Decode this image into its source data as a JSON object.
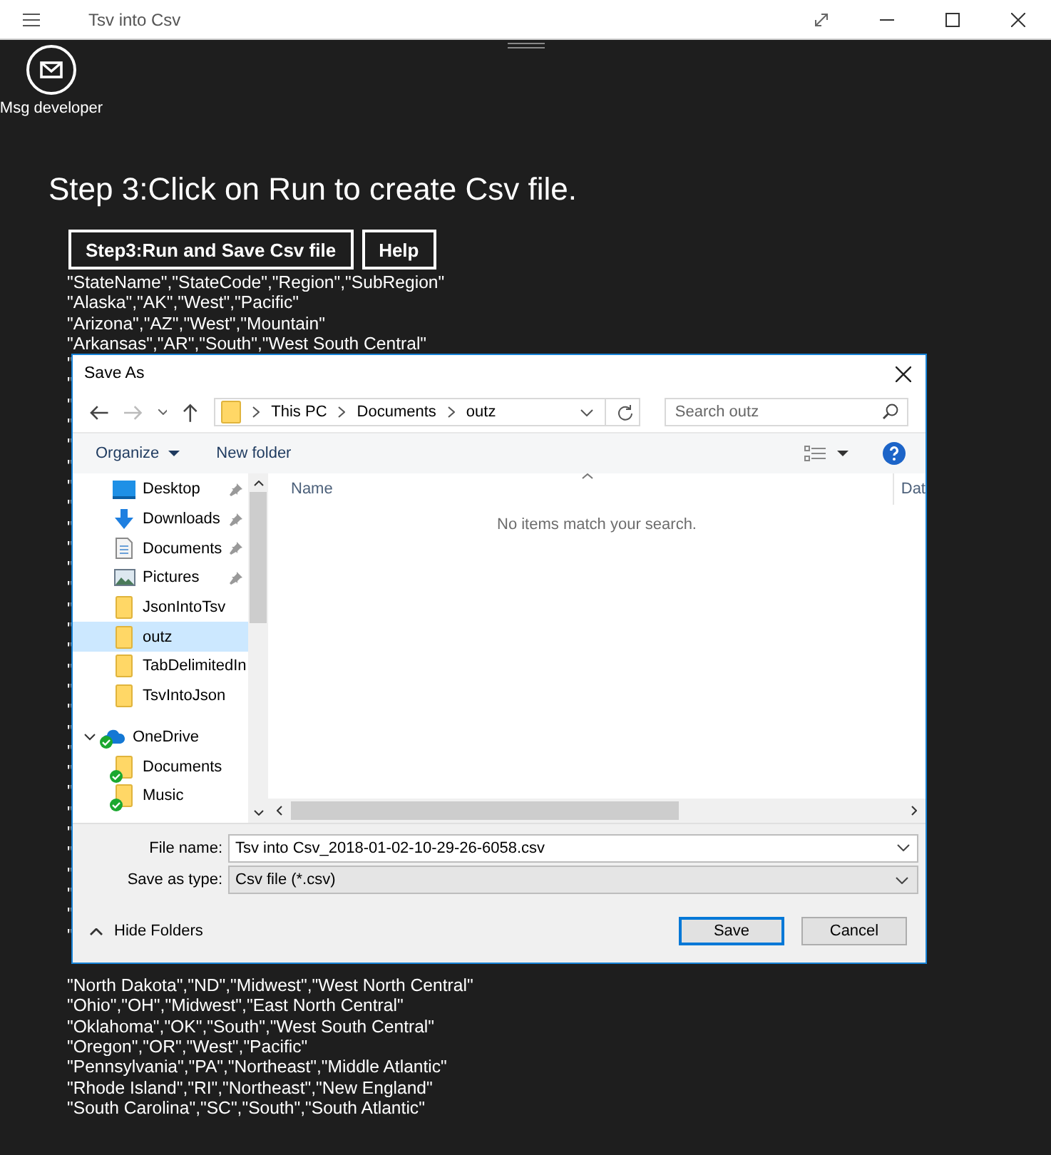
{
  "window": {
    "title": "Tsv into Csv"
  },
  "message_button": {
    "label": "Msg developer"
  },
  "heading": "Step 3:Click on Run to create Csv file.",
  "buttons": [
    "Step3:Run and Save Csv file",
    "Help"
  ],
  "csv_lines_top": [
    "\"StateName\",\"StateCode\",\"Region\",\"SubRegion\"",
    "\"Alaska\",\"AK\",\"West\",\"Pacific\"",
    "\"Arizona\",\"AZ\",\"West\",\"Mountain\"",
    "\"Arkansas\",\"AR\",\"South\",\"West South Central\""
  ],
  "csv_lines_covered": [
    "\"",
    "\"",
    "\"",
    "\"",
    "\"",
    "\"",
    "\"",
    "\"",
    "\"",
    "\"",
    "\"",
    "\"",
    "\"",
    "\"",
    "\"",
    "\"",
    "\"",
    "\"",
    "\"",
    "\"",
    "\"",
    "\"",
    "\"",
    "\"",
    "\"",
    "\"",
    "\"",
    "\"",
    "\""
  ],
  "csv_lines_bottom": [
    "\"North Dakota\",\"ND\",\"Midwest\",\"West North Central\"",
    "\"Ohio\",\"OH\",\"Midwest\",\"East North Central\"",
    "\"Oklahoma\",\"OK\",\"South\",\"West South Central\"",
    "\"Oregon\",\"OR\",\"West\",\"Pacific\"",
    "\"Pennsylvania\",\"PA\",\"Northeast\",\"Middle Atlantic\"",
    "\"Rhode Island\",\"RI\",\"Northeast\",\"New England\"",
    "\"South Carolina\",\"SC\",\"South\",\"South Atlantic\""
  ],
  "dialog": {
    "title": "Save As",
    "path": [
      "This PC",
      "Documents",
      "outz"
    ],
    "search": {
      "placeholder": "Search outz"
    },
    "toolbar": [
      "Organize",
      "New folder"
    ],
    "nav_items": [
      {
        "label": "Desktop",
        "kind": "desktop",
        "pinned": true,
        "selected": false,
        "synced": false
      },
      {
        "label": "Downloads",
        "kind": "download",
        "pinned": true,
        "selected": false,
        "synced": false
      },
      {
        "label": "Documents",
        "kind": "document",
        "pinned": true,
        "selected": false,
        "synced": false
      },
      {
        "label": "Pictures",
        "kind": "picture",
        "pinned": true,
        "selected": false,
        "synced": false
      },
      {
        "label": "JsonIntoTsv",
        "kind": "folder",
        "pinned": false,
        "selected": false,
        "synced": false
      },
      {
        "label": "outz",
        "kind": "folder",
        "pinned": false,
        "selected": true,
        "synced": false
      },
      {
        "label": "TabDelimitedIn",
        "kind": "folder",
        "pinned": false,
        "selected": false,
        "synced": false
      },
      {
        "label": "TsvIntoJson",
        "kind": "folder",
        "pinned": false,
        "selected": false,
        "synced": false
      },
      {
        "label": "OneDrive",
        "kind": "cloud",
        "pinned": false,
        "selected": false,
        "synced": true,
        "expanded": true,
        "children": [
          {
            "label": "Documents",
            "kind": "folder",
            "pinned": false,
            "selected": false,
            "synced": true
          },
          {
            "label": "Music",
            "kind": "folder",
            "pinned": false,
            "selected": false,
            "synced": true
          }
        ]
      }
    ],
    "columns": [
      "Name",
      "Dat"
    ],
    "empty_message": "No items match your search.",
    "file_name": {
      "label": "File name:",
      "value": "Tsv into Csv_2018-01-02-10-29-26-6058.csv"
    },
    "save_type": {
      "label": "Save as type:",
      "value": "Csv file (*.csv)"
    },
    "hide_folders": "Hide Folders",
    "actions": [
      "Save",
      "Cancel"
    ]
  }
}
